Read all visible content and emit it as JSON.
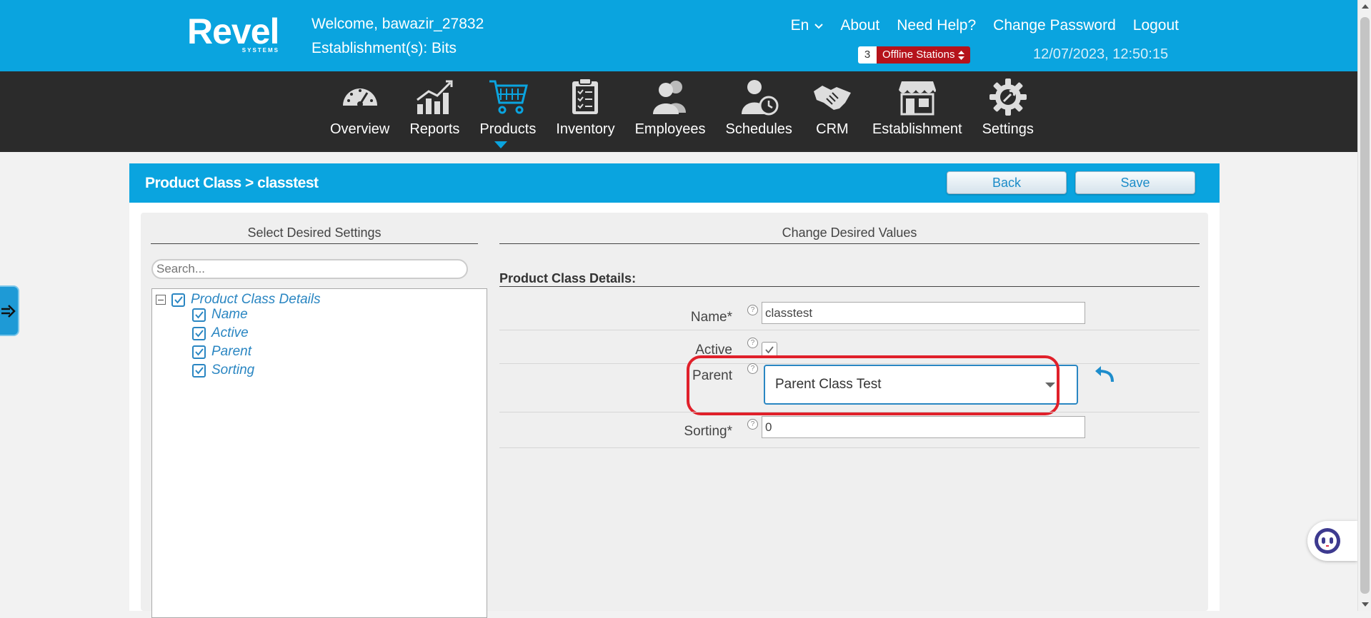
{
  "header": {
    "logo_text": "Revel",
    "logo_sub": "SYSTEMS",
    "welcome": "Welcome, bawazir_27832",
    "establishment": "Establishment(s): Bits",
    "language": "En",
    "links": {
      "about": "About",
      "help": "Need Help?",
      "change_password": "Change Password",
      "logout": "Logout"
    },
    "offline_count": "3",
    "offline_label": "Offline Stations",
    "datetime": "12/07/2023, 12:50:15"
  },
  "nav": {
    "overview": "Overview",
    "reports": "Reports",
    "products": "Products",
    "inventory": "Inventory",
    "employees": "Employees",
    "schedules": "Schedules",
    "crm": "CRM",
    "establishment": "Establishment",
    "settings": "Settings",
    "active": "Products"
  },
  "panel": {
    "breadcrumb": "Product Class > classtest",
    "back_label": "Back",
    "save_label": "Save"
  },
  "left": {
    "title": "Select Desired Settings",
    "search_placeholder": "Search...",
    "tree_root": "Product Class Details",
    "tree_items": [
      "Name",
      "Active",
      "Parent",
      "Sorting"
    ]
  },
  "right": {
    "title": "Change Desired Values",
    "section": "Product Class Details:",
    "name_label": "Name*",
    "name_value": "classtest",
    "active_label": "Active",
    "active_checked": true,
    "parent_label": "Parent",
    "parent_value": "Parent Class Test",
    "sorting_label": "Sorting*",
    "sorting_value": "0",
    "help_glyph": "?"
  },
  "colors": {
    "brand_blue": "#0aa4df",
    "nav_bg": "#2b2b2b",
    "offline_red": "#b5131b",
    "highlight_red": "#e0202a",
    "link_blue": "#2a86c2"
  }
}
